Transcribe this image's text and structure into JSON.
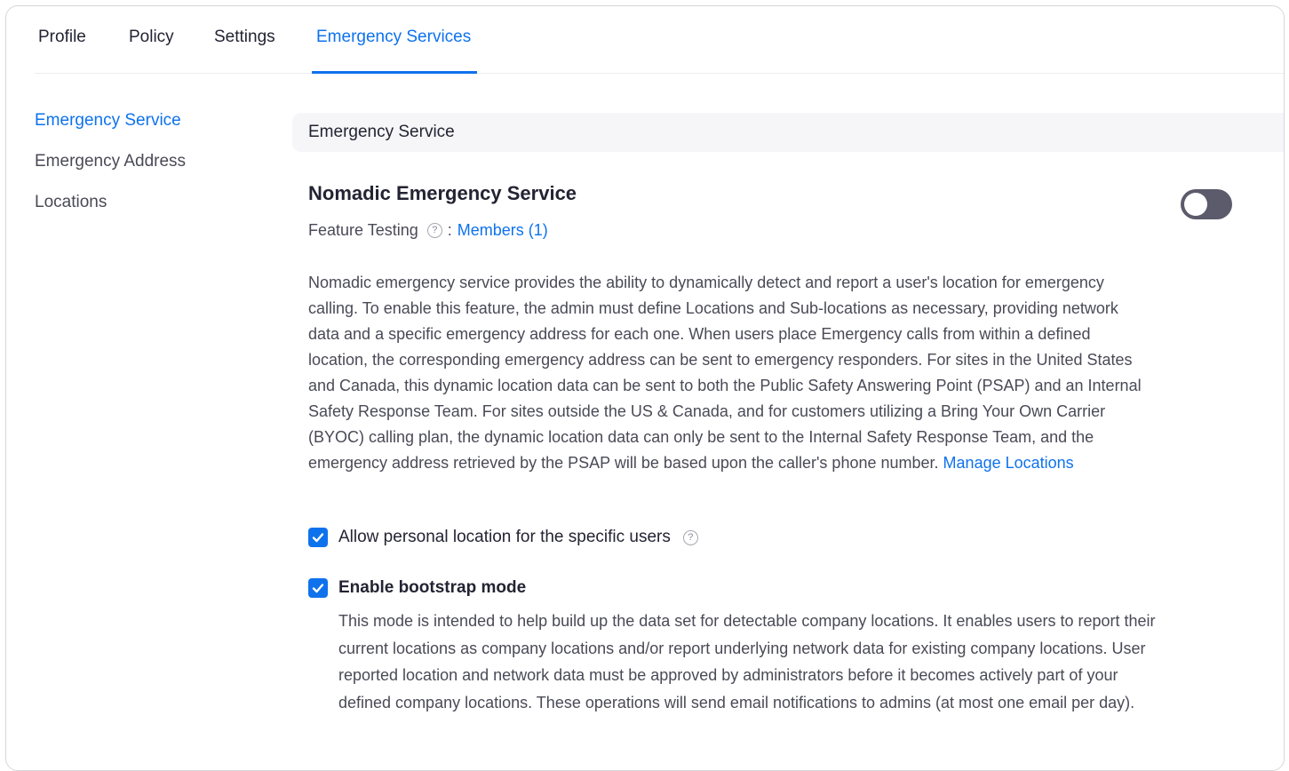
{
  "tabs": [
    {
      "label": "Profile"
    },
    {
      "label": "Policy"
    },
    {
      "label": "Settings"
    },
    {
      "label": "Emergency Services"
    }
  ],
  "active_tab": "Emergency Services",
  "sidebar": {
    "items": [
      {
        "label": "Emergency Service"
      },
      {
        "label": "Emergency Address"
      },
      {
        "label": "Locations"
      }
    ],
    "active": "Emergency Service"
  },
  "section": {
    "header": "Emergency Service"
  },
  "setting": {
    "title": "Nomadic Emergency Service",
    "toggle_on": false,
    "feature_testing_label": "Feature Testing",
    "separator": ":",
    "members_link": "Members (1)",
    "description": "Nomadic emergency service provides the ability to dynamically detect and report a user's location for emergency calling. To enable this feature, the admin must define Locations and Sub-locations as necessary, providing network data and a specific emergency address for each one. When users place Emergency calls from within a defined location, the corresponding emergency address can be sent to emergency responders. For sites in the United States and Canada, this dynamic location data can be sent to both the Public Safety Answering Point (PSAP) and an Internal Safety Response Team. For sites outside the US & Canada, and for customers utilizing a Bring Your Own Carrier (BYOC) calling plan, the dynamic location data can only be sent to the Internal Safety Response Team, and the emergency address retrieved by the PSAP will be based upon the caller's phone number.",
    "manage_link": "Manage Locations"
  },
  "options": {
    "personal_location": {
      "label": "Allow personal location for the specific users",
      "checked": true
    },
    "bootstrap": {
      "label": "Enable bootstrap mode",
      "checked": true,
      "description": "This mode is intended to help build up the data set for detectable company locations. It enables users to report their current locations as company locations and/or report underlying network data for existing company locations. User reported location and network data must be approved by administrators before it becomes actively part of your defined company locations. These operations will send email notifications to admins (at most one email per day)."
    }
  },
  "icons": {
    "help": "help-circle-icon",
    "check": "checkmark-icon"
  },
  "colors": {
    "accent": "#0e72ed",
    "toggle_off": "#5b5b6b"
  }
}
